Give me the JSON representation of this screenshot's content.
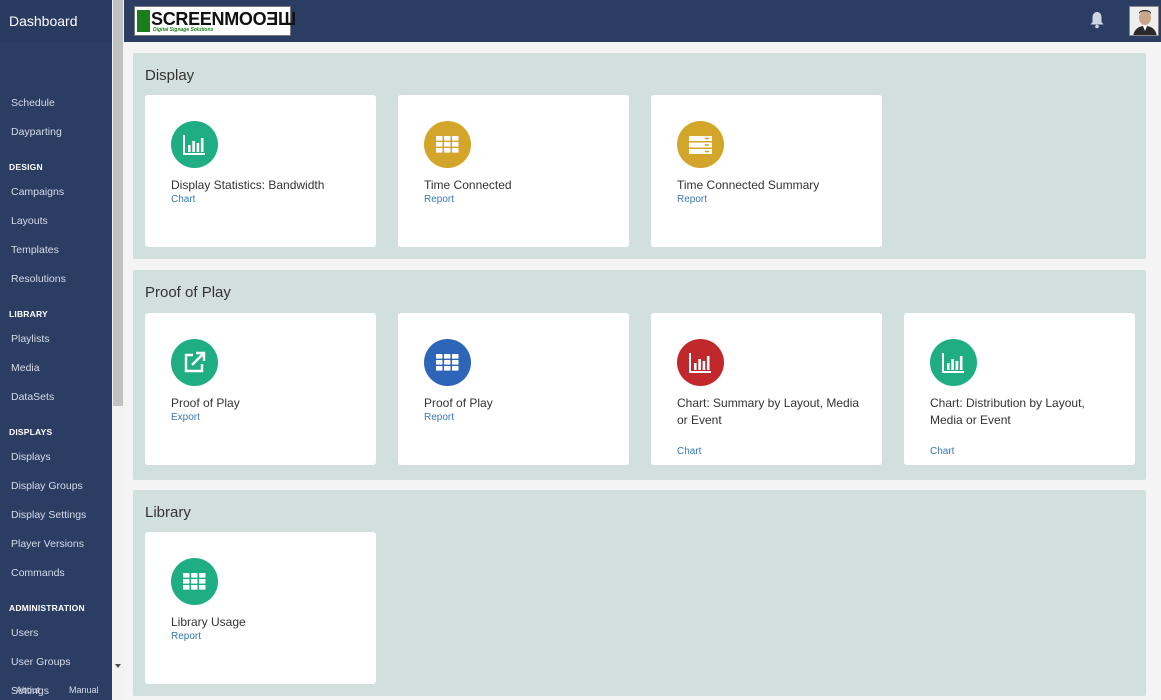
{
  "sidebar": {
    "brand": "Dashboard",
    "items": [
      {
        "label": "Schedule",
        "kind": "item"
      },
      {
        "label": "Dayparting",
        "kind": "item"
      },
      {
        "label": "DESIGN",
        "kind": "header"
      },
      {
        "label": "Campaigns",
        "kind": "item"
      },
      {
        "label": "Layouts",
        "kind": "item"
      },
      {
        "label": "Templates",
        "kind": "item"
      },
      {
        "label": "Resolutions",
        "kind": "item"
      },
      {
        "label": "LIBRARY",
        "kind": "header"
      },
      {
        "label": "Playlists",
        "kind": "item"
      },
      {
        "label": "Media",
        "kind": "item"
      },
      {
        "label": "DataSets",
        "kind": "item"
      },
      {
        "label": "DISPLAYS",
        "kind": "header"
      },
      {
        "label": "Displays",
        "kind": "item"
      },
      {
        "label": "Display Groups",
        "kind": "item"
      },
      {
        "label": "Display Settings",
        "kind": "item"
      },
      {
        "label": "Player Versions",
        "kind": "item"
      },
      {
        "label": "Commands",
        "kind": "item"
      },
      {
        "label": "ADMINISTRATION",
        "kind": "header"
      },
      {
        "label": "Users",
        "kind": "item"
      },
      {
        "label": "User Groups",
        "kind": "item"
      },
      {
        "label": "Settings",
        "kind": "item"
      }
    ],
    "footer": {
      "about": "About",
      "manual": "Manual"
    }
  },
  "topbar": {
    "logo_text": "SCREENMOOƎШ",
    "logo_tagline": "Digital Signage Solutions",
    "notification_icon": "bell-icon",
    "avatar_icon": "user-avatar"
  },
  "sections": [
    {
      "title": "Display",
      "cards": [
        {
          "title": "Display Statistics: Bandwidth",
          "type": "Chart",
          "icon": "bar-chart-icon",
          "color": "#1fae84"
        },
        {
          "title": "Time Connected",
          "type": "Report",
          "icon": "grid-icon",
          "color": "#d4a52b"
        },
        {
          "title": "Time Connected Summary",
          "type": "Report",
          "icon": "server-icon",
          "color": "#d4a52b"
        }
      ]
    },
    {
      "title": "Proof of Play",
      "cards": [
        {
          "title": "Proof of Play",
          "type": "Export",
          "icon": "external-link-icon",
          "color": "#1fae84"
        },
        {
          "title": "Proof of Play",
          "type": "Report",
          "icon": "grid-icon",
          "color": "#2d65b8"
        },
        {
          "title": "Chart: Summary by Layout, Media or Event",
          "type": "Chart",
          "icon": "bar-chart-icon",
          "color": "#c0282b"
        },
        {
          "title": "Chart: Distribution by Layout, Media or Event",
          "type": "Chart",
          "icon": "bar-chart-icon",
          "color": "#1fae84"
        }
      ]
    },
    {
      "title": "Library",
      "cards": [
        {
          "title": "Library Usage",
          "type": "Report",
          "icon": "grid-icon",
          "color": "#1fae84"
        }
      ]
    }
  ]
}
